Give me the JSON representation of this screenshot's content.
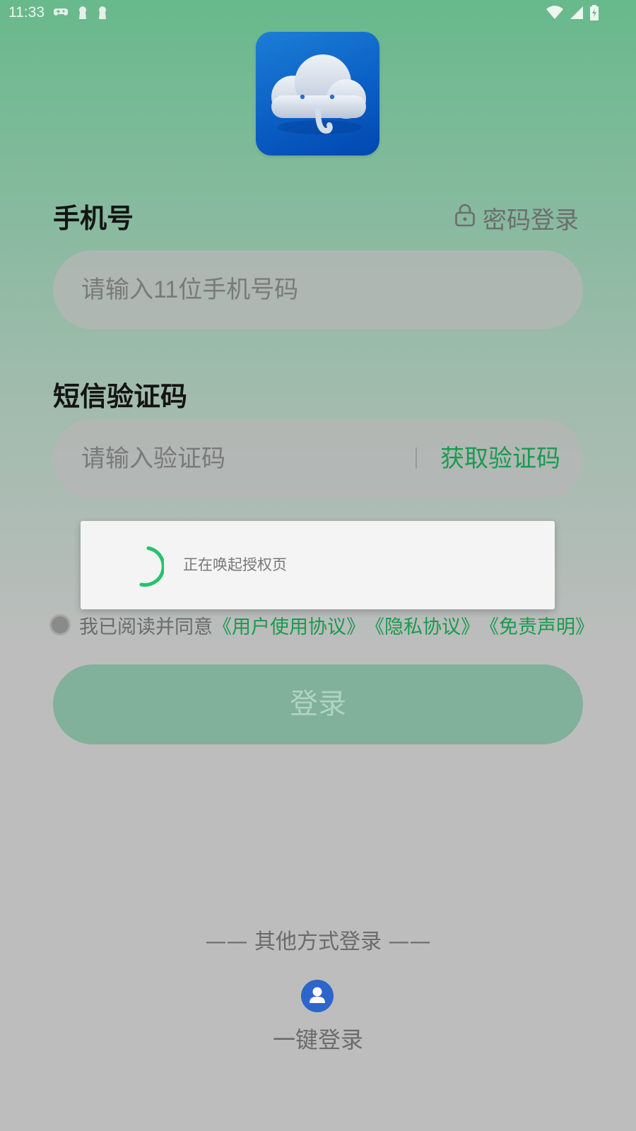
{
  "status_bar": {
    "time": "11:33",
    "left_icons": [
      "gamepad-icon",
      "keyhole-icon",
      "keyhole-icon"
    ],
    "right_icons": [
      "wifi-icon",
      "signal-icon",
      "battery-charging-icon"
    ]
  },
  "app": {
    "logo_icon": "cloud-elephant-logo"
  },
  "phone": {
    "label": "手机号",
    "password_login": "密码登录",
    "placeholder": "请输入11位手机号码"
  },
  "sms": {
    "label": "短信验证码",
    "placeholder": "请输入验证码",
    "get_code": "获取验证码"
  },
  "dialog": {
    "text": "正在唤起授权页"
  },
  "agreement": {
    "prefix": "我已阅读并同意",
    "links": [
      "《用户使用协议》",
      "《隐私协议》",
      "《免责声明》"
    ]
  },
  "login": {
    "label": "登录"
  },
  "other": {
    "title": "—— 其他方式登录 ——",
    "one_click_label": "一键登录"
  },
  "colors": {
    "accent_green": "#1a9a4f",
    "spinner_green": "#23c36c",
    "one_click_blue": "#2c65cc"
  }
}
